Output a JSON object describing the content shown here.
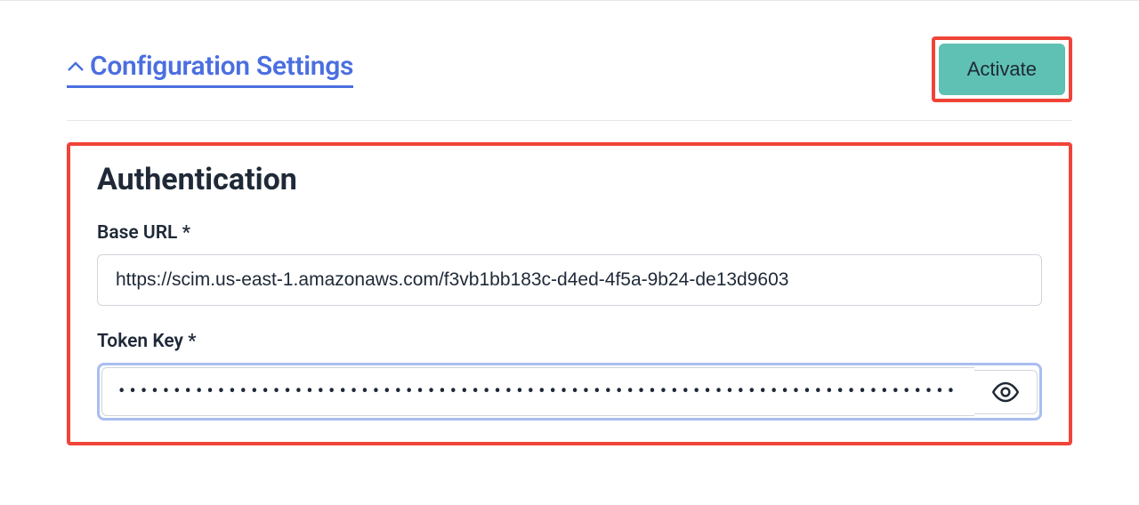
{
  "header": {
    "section_title": "Configuration Settings",
    "activate_label": "Activate"
  },
  "auth": {
    "heading": "Authentication",
    "base_url": {
      "label": "Base URL *",
      "value": "https://scim.us-east-1.amazonaws.com/f3vb1bb183c-d4ed-4f5a-9b24-de13d9603"
    },
    "token_key": {
      "label": "Token Key *",
      "value": "••••••••••••••••••••••••••••••••••••••••••••••••••••••••••••••••••••••••••••••••••••••"
    }
  },
  "colors": {
    "accent_blue": "#4b6fe0",
    "activate_bg": "#5fc1b3",
    "highlight_border": "#f04438",
    "focus_ring": "#a9bdf0"
  }
}
